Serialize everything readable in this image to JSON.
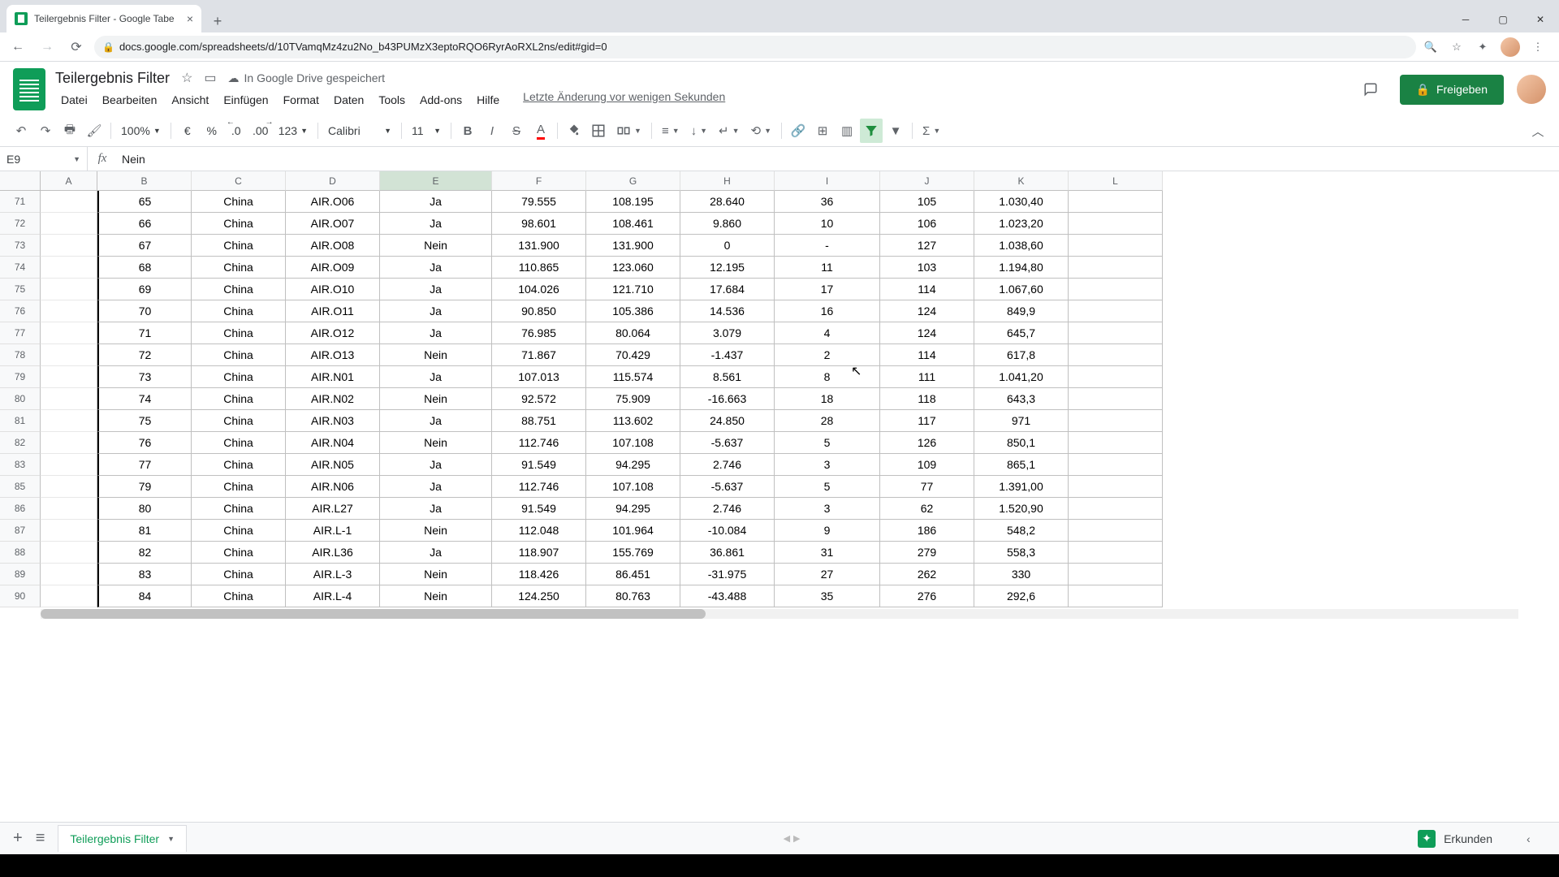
{
  "browser": {
    "tab_title": "Teilergebnis Filter - Google Tabe",
    "url": "docs.google.com/spreadsheets/d/10TVamqMz4zu2No_b43PUMzX3eptoRQO6RyrAoRXL2ns/edit#gid=0"
  },
  "doc": {
    "title": "Teilergebnis Filter",
    "save_status": "In Google Drive gespeichert",
    "last_edit": "Letzte Änderung vor wenigen Sekunden",
    "share_label": "Freigeben"
  },
  "menu": [
    "Datei",
    "Bearbeiten",
    "Ansicht",
    "Einfügen",
    "Format",
    "Daten",
    "Tools",
    "Add-ons",
    "Hilfe"
  ],
  "toolbar": {
    "zoom": "100%",
    "currency": "€",
    "percent": "%",
    "dec_dec": ".0",
    "dec_inc": ".00",
    "numfmt": "123",
    "font": "Calibri",
    "fontsize": "11"
  },
  "namebox": "E9",
  "formula": "Nein",
  "columns": [
    "",
    "A",
    "B",
    "C",
    "D",
    "E",
    "F",
    "G",
    "H",
    "I",
    "J",
    "K",
    "L"
  ],
  "rows": [
    {
      "n": "71",
      "A": "",
      "B": "65",
      "C": "China",
      "D": "AIR.O06",
      "E": "Ja",
      "F": "79.555",
      "G": "108.195",
      "H": "28.640",
      "I": "36",
      "J": "105",
      "K": "1.030,40",
      "L": ""
    },
    {
      "n": "72",
      "A": "",
      "B": "66",
      "C": "China",
      "D": "AIR.O07",
      "E": "Ja",
      "F": "98.601",
      "G": "108.461",
      "H": "9.860",
      "I": "10",
      "J": "106",
      "K": "1.023,20",
      "L": ""
    },
    {
      "n": "73",
      "A": "",
      "B": "67",
      "C": "China",
      "D": "AIR.O08",
      "E": "Nein",
      "F": "131.900",
      "G": "131.900",
      "H": "0",
      "I": "-",
      "J": "127",
      "K": "1.038,60",
      "L": ""
    },
    {
      "n": "74",
      "A": "",
      "B": "68",
      "C": "China",
      "D": "AIR.O09",
      "E": "Ja",
      "F": "110.865",
      "G": "123.060",
      "H": "12.195",
      "I": "11",
      "J": "103",
      "K": "1.194,80",
      "L": ""
    },
    {
      "n": "75",
      "A": "",
      "B": "69",
      "C": "China",
      "D": "AIR.O10",
      "E": "Ja",
      "F": "104.026",
      "G": "121.710",
      "H": "17.684",
      "I": "17",
      "J": "114",
      "K": "1.067,60",
      "L": ""
    },
    {
      "n": "76",
      "A": "",
      "B": "70",
      "C": "China",
      "D": "AIR.O11",
      "E": "Ja",
      "F": "90.850",
      "G": "105.386",
      "H": "14.536",
      "I": "16",
      "J": "124",
      "K": "849,9",
      "L": ""
    },
    {
      "n": "77",
      "A": "",
      "B": "71",
      "C": "China",
      "D": "AIR.O12",
      "E": "Ja",
      "F": "76.985",
      "G": "80.064",
      "H": "3.079",
      "I": "4",
      "J": "124",
      "K": "645,7",
      "L": ""
    },
    {
      "n": "78",
      "A": "",
      "B": "72",
      "C": "China",
      "D": "AIR.O13",
      "E": "Nein",
      "F": "71.867",
      "G": "70.429",
      "H": "-1.437",
      "I": "2",
      "J": "114",
      "K": "617,8",
      "L": ""
    },
    {
      "n": "79",
      "A": "",
      "B": "73",
      "C": "China",
      "D": "AIR.N01",
      "E": "Ja",
      "F": "107.013",
      "G": "115.574",
      "H": "8.561",
      "I": "8",
      "J": "111",
      "K": "1.041,20",
      "L": ""
    },
    {
      "n": "80",
      "A": "",
      "B": "74",
      "C": "China",
      "D": "AIR.N02",
      "E": "Nein",
      "F": "92.572",
      "G": "75.909",
      "H": "-16.663",
      "I": "18",
      "J": "118",
      "K": "643,3",
      "L": ""
    },
    {
      "n": "81",
      "A": "",
      "B": "75",
      "C": "China",
      "D": "AIR.N03",
      "E": "Ja",
      "F": "88.751",
      "G": "113.602",
      "H": "24.850",
      "I": "28",
      "J": "117",
      "K": "971",
      "L": ""
    },
    {
      "n": "82",
      "A": "",
      "B": "76",
      "C": "China",
      "D": "AIR.N04",
      "E": "Nein",
      "F": "112.746",
      "G": "107.108",
      "H": "-5.637",
      "I": "5",
      "J": "126",
      "K": "850,1",
      "L": ""
    },
    {
      "n": "83",
      "A": "",
      "B": "77",
      "C": "China",
      "D": "AIR.N05",
      "E": "Ja",
      "F": "91.549",
      "G": "94.295",
      "H": "2.746",
      "I": "3",
      "J": "109",
      "K": "865,1",
      "L": ""
    },
    {
      "n": "85",
      "A": "",
      "B": "79",
      "C": "China",
      "D": "AIR.N06",
      "E": "Ja",
      "F": "112.746",
      "G": "107.108",
      "H": "-5.637",
      "I": "5",
      "J": "77",
      "K": "1.391,00",
      "L": ""
    },
    {
      "n": "86",
      "A": "",
      "B": "80",
      "C": "China",
      "D": "AIR.L27",
      "E": "Ja",
      "F": "91.549",
      "G": "94.295",
      "H": "2.746",
      "I": "3",
      "J": "62",
      "K": "1.520,90",
      "L": ""
    },
    {
      "n": "87",
      "A": "",
      "B": "81",
      "C": "China",
      "D": "AIR.L-1",
      "E": "Nein",
      "F": "112.048",
      "G": "101.964",
      "H": "-10.084",
      "I": "9",
      "J": "186",
      "K": "548,2",
      "L": ""
    },
    {
      "n": "88",
      "A": "",
      "B": "82",
      "C": "China",
      "D": "AIR.L36",
      "E": "Ja",
      "F": "118.907",
      "G": "155.769",
      "H": "36.861",
      "I": "31",
      "J": "279",
      "K": "558,3",
      "L": ""
    },
    {
      "n": "89",
      "A": "",
      "B": "83",
      "C": "China",
      "D": "AIR.L-3",
      "E": "Nein",
      "F": "118.426",
      "G": "86.451",
      "H": "-31.975",
      "I": "27",
      "J": "262",
      "K": "330",
      "L": ""
    },
    {
      "n": "90",
      "A": "",
      "B": "84",
      "C": "China",
      "D": "AIR.L-4",
      "E": "Nein",
      "F": "124.250",
      "G": "80.763",
      "H": "-43.488",
      "I": "35",
      "J": "276",
      "K": "292,6",
      "L": ""
    }
  ],
  "sheet_tab": "Teilergebnis Filter",
  "explore": "Erkunden"
}
